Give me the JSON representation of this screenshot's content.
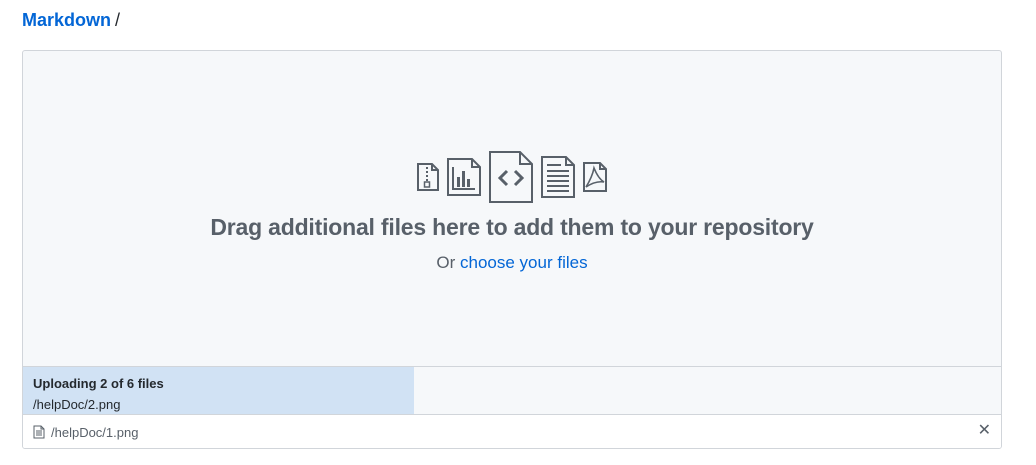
{
  "breadcrumb": {
    "repo": "Markdown",
    "separator": "/"
  },
  "dropzone": {
    "title": "Drag additional files here to add them to your repository",
    "prefix": "Or",
    "link": "choose your files",
    "icons": [
      "file-zip-icon",
      "graph-icon",
      "file-code-icon",
      "file-text-icon",
      "file-pdf-icon"
    ]
  },
  "upload": {
    "status": "Uploading 2 of 6 files",
    "current_file": "/helpDoc/2.png",
    "progress": 0.4
  },
  "files": [
    {
      "name": "/helpDoc/1.png",
      "remove": "✕"
    }
  ],
  "colors": {
    "link": "#0366d6",
    "progress": "#d1e2f4",
    "background": "#f6f8fa"
  }
}
